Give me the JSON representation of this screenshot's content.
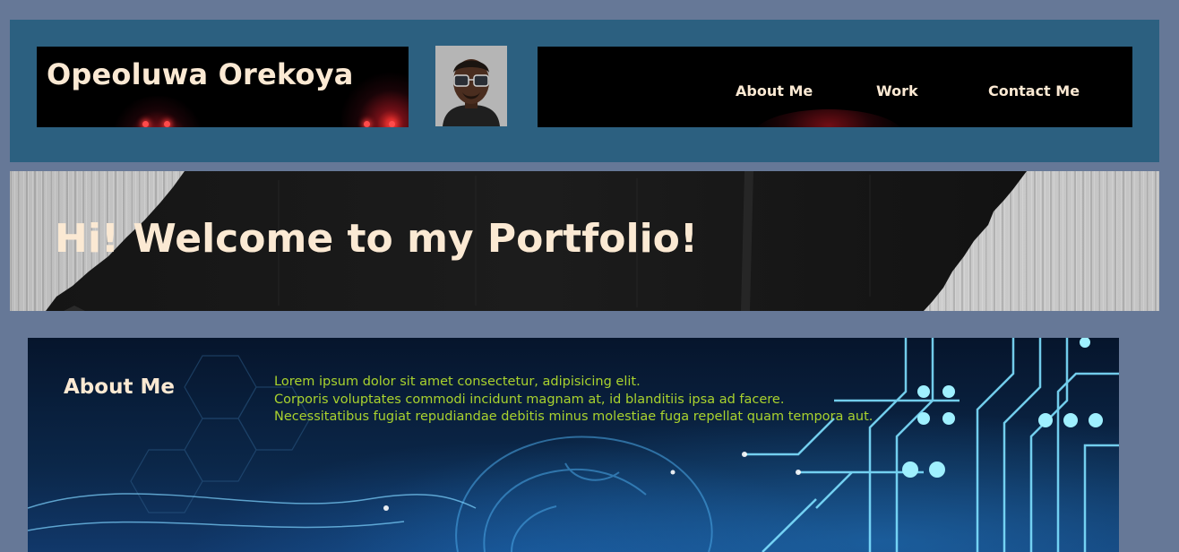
{
  "header": {
    "site_name": "Opeoluwa Orekoya",
    "avatar_alt": "Opeoluwa Orekoya",
    "nav": [
      {
        "label": "About Me"
      },
      {
        "label": "Work"
      },
      {
        "label": "Contact Me"
      }
    ]
  },
  "hero": {
    "title": "Hi! Welcome to my Portfolio!"
  },
  "about": {
    "heading": "About Me",
    "lines": [
      "Lorem ipsum dolor sit amet consectetur, adipisicing elit.",
      "Corporis voluptates commodi incidunt magnam at, id blanditiis ipsa ad facere.",
      "Necessitatibus fugiat repudiandae debitis minus molestiae fuga repellat quam tempora aut."
    ]
  },
  "colors": {
    "page_background": "#667897",
    "header_background": "#2c6080",
    "heading_text": "#fbe9d3",
    "body_text": "#a9d22e"
  }
}
